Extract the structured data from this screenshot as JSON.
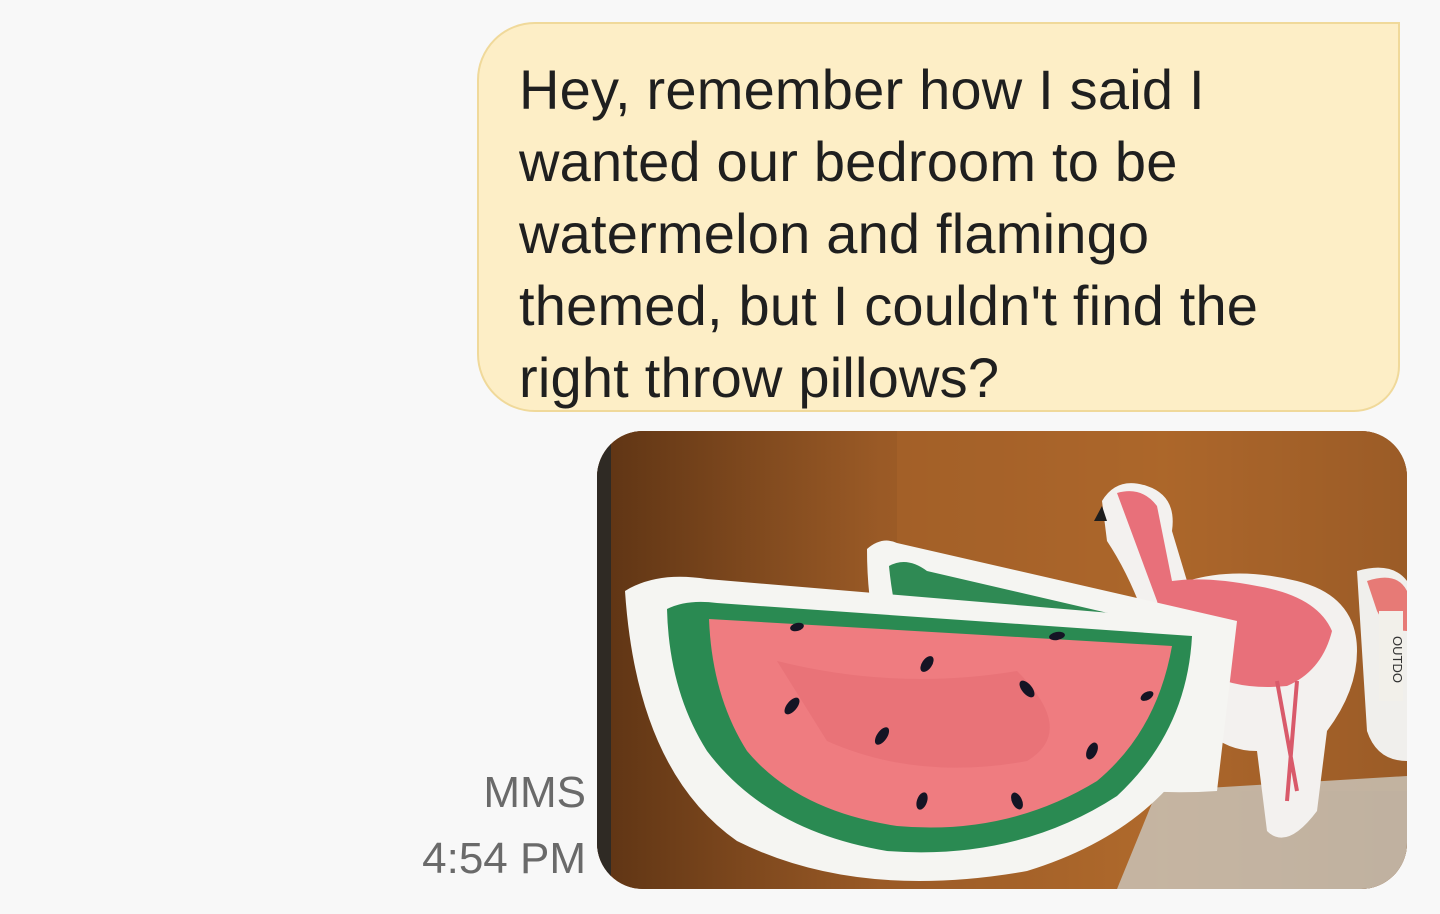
{
  "message": {
    "text": "Hey, remember how I said I wanted our bedroom to be watermelon and flamingo themed, but I couldn't find the right throw pillows?",
    "lines": [
      "Hey, remember how I said I",
      "wanted our bedroom to be",
      "watermelon and flamingo",
      "themed, but I couldn't find the",
      "right throw pillows?"
    ]
  },
  "attachment": {
    "type_label": "MMS",
    "timestamp": "4:54 PM",
    "subject": "watermelon and flamingo throw pillows on a wooden shelf",
    "tag_text": "OUTDO"
  },
  "colors": {
    "bubble_bg": "#fdeec6",
    "bubble_border": "#f0d99a",
    "text": "#1f1f1f",
    "meta_text": "#6a6a6a"
  }
}
